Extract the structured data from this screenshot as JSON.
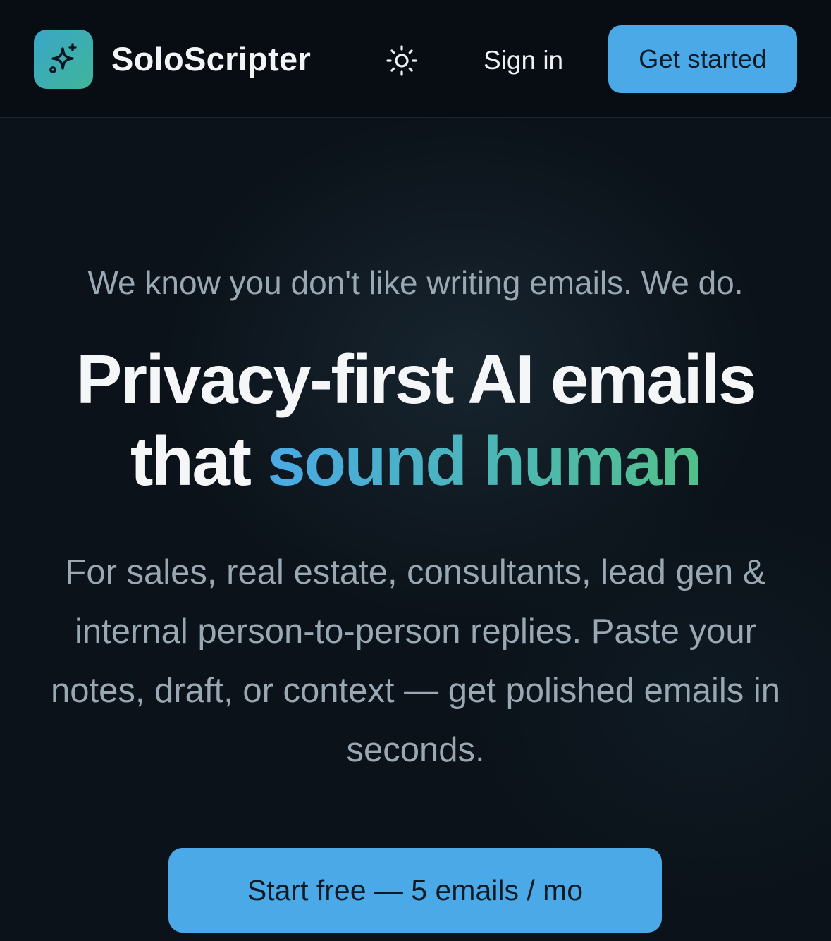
{
  "header": {
    "brand": "SoloScripter",
    "signin_label": "Sign in",
    "get_started_label": "Get started"
  },
  "hero": {
    "tagline": "We know you don't like writing emails. We do.",
    "headline_line1": "Privacy-first AI emails",
    "headline_line2_plain": "that",
    "headline_line2_gradient": "sound human",
    "description": "For sales, real estate, consultants, lead gen & internal person-to-person replies. Paste your notes, draft, or context — get polished emails in seconds.",
    "cta_label": "Start free — 5 emails / mo"
  },
  "icons": {
    "logo": "sparkles-icon",
    "theme": "sun-icon"
  },
  "colors": {
    "accent": "#4aa9e6",
    "gradient_start": "#4aa9e6",
    "gradient_end": "#52c08a",
    "background": "#0b1219"
  }
}
